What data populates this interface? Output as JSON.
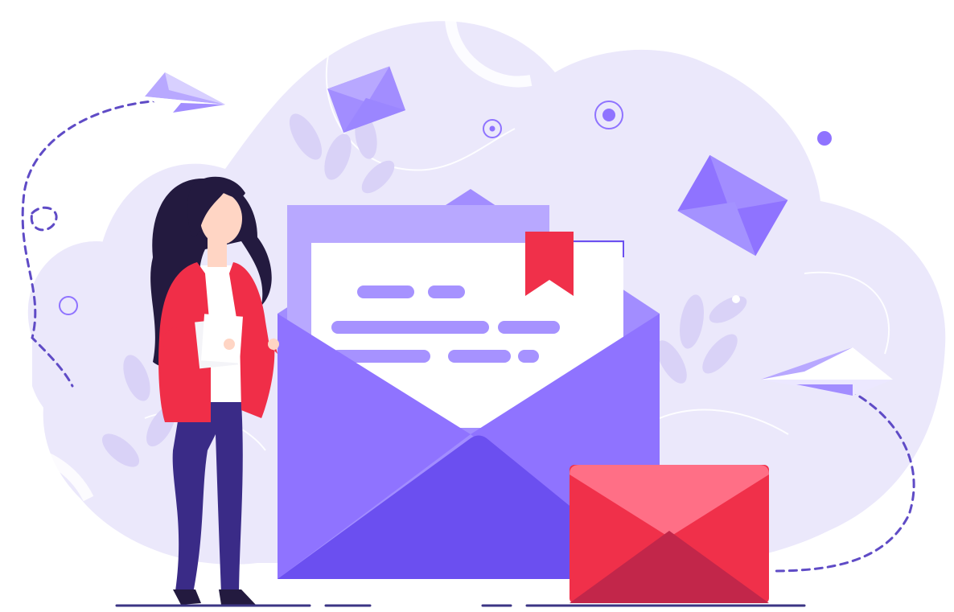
{
  "illustration": {
    "subject": "email-marketing-illustration",
    "elements": [
      "woman-figure",
      "open-envelope-icon",
      "letter-card",
      "bookmark-ribbon-icon",
      "closed-red-envelope-icon",
      "paper-plane-icon",
      "floating-envelope-icon",
      "leaf-decoration"
    ]
  },
  "colors": {
    "background_blob": "#ebe8fb",
    "background_blob_light": "#f3f1fd",
    "leaf": "#d9d2f7",
    "purple_primary": "#8f73ff",
    "purple_dark": "#6b4ff0",
    "purple_mid": "#a28dff",
    "purple_light": "#b8a8ff",
    "letter_paper": "#ffffff",
    "text_line": "#a692ff",
    "red_primary": "#f0304a",
    "red_light": "#ff6f86",
    "red_dark": "#c2264a",
    "woman_jacket": "#f02e48",
    "woman_pants": "#3a2b87",
    "woman_hair": "#231a3f",
    "skin": "#ffd5c4",
    "dash": "#5f4bc6",
    "ground_line": "#3b3484"
  }
}
